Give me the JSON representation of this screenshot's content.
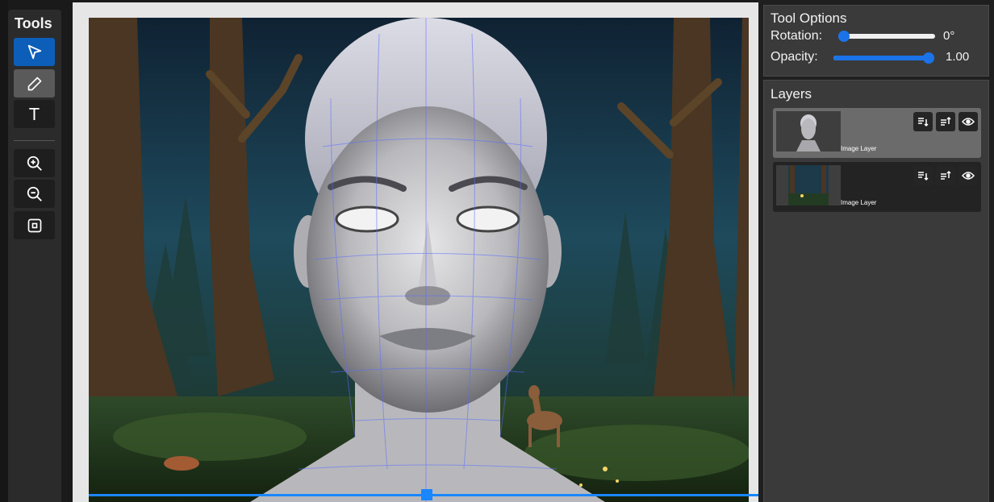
{
  "toolbar": {
    "title": "Tools",
    "tools": [
      {
        "name": "select",
        "icon": "cursor-icon",
        "state": "active"
      },
      {
        "name": "draw",
        "icon": "pencil-icon",
        "state": "hover"
      },
      {
        "name": "text",
        "icon": "text-icon",
        "state": "normal",
        "glyph": "T"
      },
      {
        "name": "zoom-in",
        "icon": "zoom-in-icon",
        "state": "normal"
      },
      {
        "name": "zoom-out",
        "icon": "zoom-out-icon",
        "state": "normal"
      },
      {
        "name": "fit",
        "icon": "fit-frame-icon",
        "state": "normal"
      }
    ]
  },
  "tool_options": {
    "title": "Tool Options",
    "rotation_label": "Rotation:",
    "rotation_value": "0°",
    "rotation_fraction": 0.0,
    "opacity_label": "Opacity:",
    "opacity_value": "1.00",
    "opacity_fraction": 1.0
  },
  "layers": {
    "title": "Layers",
    "items": [
      {
        "name": "Image Layer",
        "selected": true,
        "thumb": "woman-portrait"
      },
      {
        "name": "Image Layer",
        "selected": false,
        "thumb": "forest-night"
      }
    ],
    "actions": [
      "move-down-icon",
      "move-up-icon",
      "visibility-eye-icon"
    ]
  },
  "colors": {
    "accent": "#1a73e8",
    "selection": "#1a86ff",
    "active_tool": "#0d5eb8",
    "panel": "#3a3a3a"
  }
}
